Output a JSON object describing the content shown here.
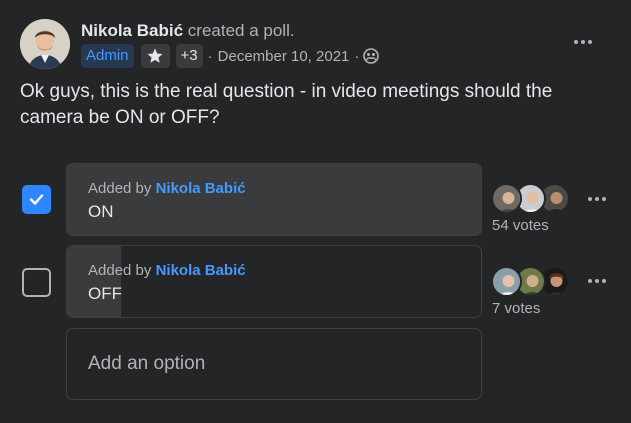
{
  "post": {
    "author_name": "Nikola Babić",
    "action_text": "created a poll.",
    "badges": {
      "admin_label": "Admin",
      "star_icon": "star-icon",
      "extra_count": "+3"
    },
    "separator": "·",
    "date": "December 10, 2021",
    "privacy_icon": "members-icon",
    "question": "Ok guys, this is the real question - in video meetings should the camera be ON or OFF?"
  },
  "poll": {
    "options": [
      {
        "added_by_prefix": "Added by",
        "added_by_name": "Nikola Babić",
        "label": "ON",
        "checked": true,
        "votes_text": "54 votes",
        "votes": 54,
        "share": 1.0
      },
      {
        "added_by_prefix": "Added by",
        "added_by_name": "Nikola Babić",
        "label": "OFF",
        "checked": false,
        "votes_text": "7 votes",
        "votes": 7,
        "share": 0.13
      }
    ],
    "add_option_placeholder": "Add an option"
  },
  "colors": {
    "background": "#242526",
    "accent_blue": "#2d88ff",
    "link_blue": "#4599ff",
    "text_primary": "#e4e6eb",
    "text_secondary": "#b0b3b8",
    "bar_fill": "#3a3b3c",
    "border": "#3e4042"
  }
}
